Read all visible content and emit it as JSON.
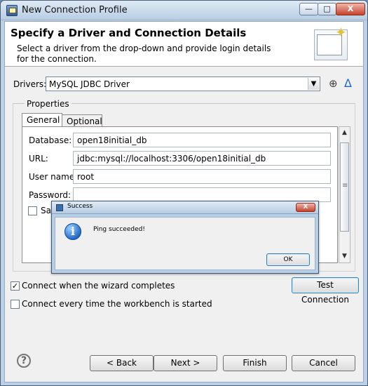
{
  "window": {
    "title": "New Connection Profile",
    "controls": {
      "minimize": "—",
      "maximize": "□",
      "close": "X"
    }
  },
  "banner": {
    "title": "Specify a Driver and Connection Details",
    "description": "Select a driver from the drop-down and provide login details for the connection."
  },
  "drivers": {
    "label": "Drivers:",
    "selected": "MySQL JDBC Driver",
    "actions": {
      "add_icon": "new-driver-icon",
      "edit_icon": "driver-delta-icon"
    }
  },
  "properties": {
    "label": "Properties",
    "tabs": {
      "general": "General",
      "optional": "Optional"
    },
    "fields": {
      "database": {
        "label": "Database:",
        "value": "open18initial_db"
      },
      "url": {
        "label": "URL:",
        "value": "jdbc:mysql://localhost:3306/open18initial_db"
      },
      "user_name": {
        "label": "User name:",
        "value": "root"
      },
      "password": {
        "label": "Password:",
        "value": ""
      }
    },
    "save_checkbox_label": "Sav"
  },
  "dialog": {
    "title": "Success",
    "message": "Ping succeeded!",
    "ok": "OK",
    "close": "X"
  },
  "options": {
    "connect_when_completes": {
      "label": "Connect when the wizard completes",
      "checked": true
    },
    "connect_every_time": {
      "label": "Connect every time the workbench is started",
      "checked": false
    }
  },
  "buttons": {
    "test_connection": "Test Connection",
    "back": "< Back",
    "next": "Next >",
    "finish": "Finish",
    "cancel": "Cancel"
  },
  "icons": {
    "help": "help-icon",
    "info": "info-icon"
  },
  "colors": {
    "title_bar": "#b8cde3",
    "focus_border": "#3c7fb1",
    "info_blue": "#2065c3"
  }
}
